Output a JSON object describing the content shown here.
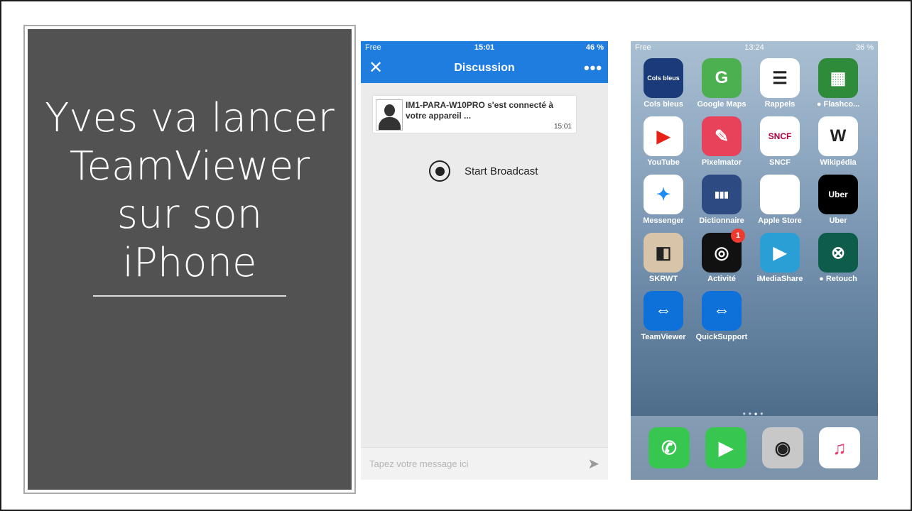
{
  "slide": {
    "title": "Yves va lancer TeamViewer sur son iPhone"
  },
  "discussion_phone": {
    "status": {
      "carrier": "Free",
      "time": "15:01",
      "battery": "46 %"
    },
    "nav": {
      "close": "✕",
      "title": "Discussion",
      "more": "•••"
    },
    "message": {
      "text": "IM1-PARA-W10PRO s'est connecté à votre appareil ...",
      "time": "15:01"
    },
    "broadcast_label": "Start Broadcast",
    "input_placeholder": "Tapez votre message ici"
  },
  "home_phone": {
    "status": {
      "carrier": "Free",
      "time": "13:24",
      "battery": "36 %"
    },
    "apps": [
      {
        "name": "Cols bleus",
        "label": "Cols bleus",
        "glyph": "Cols bleus",
        "color": "#1b3a7a"
      },
      {
        "name": "Google Maps",
        "label": "Google Maps",
        "glyph": "G",
        "color": "#4caf50"
      },
      {
        "name": "Rappels",
        "label": "Rappels",
        "glyph": "☰",
        "color": "#ffffff"
      },
      {
        "name": "Flashcode",
        "label": "● Flashco...",
        "glyph": "▦",
        "color": "#2e8b3a"
      },
      {
        "name": "YouTube",
        "label": "YouTube",
        "glyph": "▶",
        "color": "#ffffff"
      },
      {
        "name": "Pixelmator",
        "label": "Pixelmator",
        "glyph": "✎",
        "color": "#e8425a"
      },
      {
        "name": "SNCF",
        "label": "SNCF",
        "glyph": "SNCF",
        "color": "#ffffff"
      },
      {
        "name": "Wikipédia",
        "label": "Wikipédia",
        "glyph": "W",
        "color": "#ffffff"
      },
      {
        "name": "Messenger",
        "label": "Messenger",
        "glyph": "✦",
        "color": "#ffffff"
      },
      {
        "name": "Dictionnaire",
        "label": "Dictionnaire",
        "glyph": "▮▮▮",
        "color": "#2e4a82"
      },
      {
        "name": "Apple Store",
        "label": "Apple Store",
        "glyph": "",
        "color": "#ffffff"
      },
      {
        "name": "Uber",
        "label": "Uber",
        "glyph": "Uber",
        "color": "#000000"
      },
      {
        "name": "SKRWT",
        "label": "SKRWT",
        "glyph": "◧",
        "color": "#d8c4a8"
      },
      {
        "name": "Activité",
        "label": "Activité",
        "glyph": "◎",
        "color": "#111111",
        "badge": "1"
      },
      {
        "name": "iMediaShare",
        "label": "iMediaShare",
        "glyph": "▶",
        "color": "#2a9fd6"
      },
      {
        "name": "Retouch",
        "label": "● Retouch",
        "glyph": "⊗",
        "color": "#0e5c4a"
      },
      {
        "name": "TeamViewer",
        "label": "TeamViewer",
        "glyph": "⇔",
        "color": "#0e70d9"
      },
      {
        "name": "QuickSupport",
        "label": "QuickSupport",
        "glyph": "⇔",
        "color": "#0e70d9"
      }
    ],
    "page_dots": [
      "•",
      "•",
      "•",
      "•"
    ],
    "dock": [
      {
        "name": "Téléphone",
        "glyph": "✆",
        "color": "#37c650"
      },
      {
        "name": "FaceTime",
        "glyph": "▶",
        "color": "#37c650"
      },
      {
        "name": "Appareil photo",
        "glyph": "◉",
        "color": "#c8c8c8"
      },
      {
        "name": "Musique",
        "glyph": "♫",
        "color": "#ffffff"
      }
    ]
  }
}
